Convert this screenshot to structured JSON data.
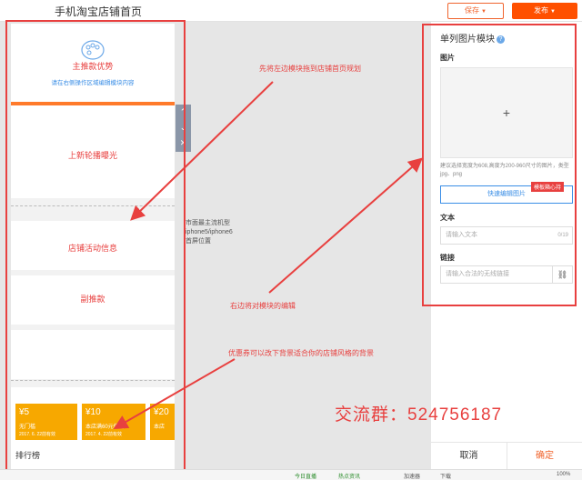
{
  "header": {
    "title": "手机淘宝店铺首页",
    "save_label": "保存",
    "publish_label": "发布"
  },
  "canvas": {
    "module1": {
      "title": "主推款优势",
      "hint": "请在右侧操作区域编辑模块内容"
    },
    "module2": {
      "title": "上新轮播曝光"
    },
    "module3": {
      "title": "店铺活动信息"
    },
    "module4": {
      "title": "副推款"
    },
    "coupons": [
      {
        "value": "¥5",
        "condition": "无门槛",
        "date": "2017. 6. 22前有效"
      },
      {
        "value": "¥10",
        "condition": "本店满60元使用",
        "date": "2017. 4. 22前有效"
      },
      {
        "value": "¥20",
        "condition": "本店",
        "date": ""
      }
    ],
    "ranking_label": "排行榜",
    "phone_note": [
      "市面最主流机型",
      "iphone5/iphone6",
      "首屏位置"
    ],
    "side_controls": [
      "⌃",
      "⌄",
      "✕"
    ]
  },
  "annotations": {
    "drag_tip": "先将左边模块拖到店铺首页规划",
    "edit_tip": "右边将对模块的编辑",
    "coupon_tip": "优惠券可以改下背景适合你的店铺风格的背景",
    "group": "交流群：524756187"
  },
  "panel": {
    "title": "单列图片模块",
    "image_label": "图片",
    "image_plus": "+",
    "image_hint": "建议选择宽度为608,高度为200-960尺寸的图片，类型jpg、png",
    "quick_edit_label": "快速编辑图片",
    "badge": "模板箱心持",
    "text_label": "文本",
    "text_placeholder": "请输入文本",
    "text_count": "0/19",
    "link_label": "链接",
    "link_placeholder": "请输入合法的无线链接",
    "cancel_label": "取消",
    "ok_label": "确定"
  },
  "statusbar": {
    "live": "今日直播",
    "acc": "热点资讯",
    "speed": "加速器",
    "download": "下载",
    "zoom": "100%"
  },
  "colors": {
    "accent": "#ff5000",
    "annotation": "#e8403f",
    "coupon": "#f7a800",
    "link": "#3a8ee6"
  }
}
